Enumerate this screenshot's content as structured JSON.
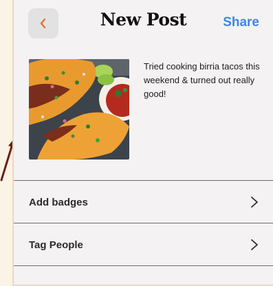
{
  "header": {
    "title": "New Post",
    "share_label": "Share"
  },
  "post": {
    "caption": "Tried cooking birria tacos this weekend & turned out really good!"
  },
  "rows": [
    {
      "label": "Add badges"
    },
    {
      "label": "Tag People"
    }
  ],
  "colors": {
    "accent": "#3d86e8",
    "arrow": "#6b1f14"
  }
}
